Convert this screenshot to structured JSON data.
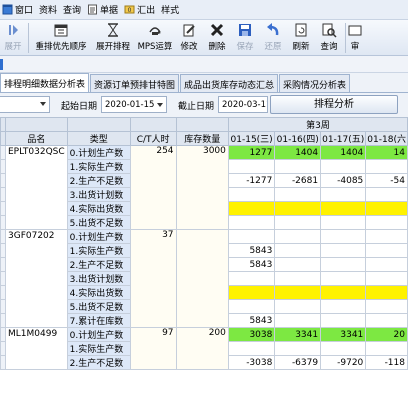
{
  "menubar": {
    "items": [
      {
        "label": "窗口",
        "icon": "window-icon"
      },
      {
        "label": "资料",
        "icon": ""
      },
      {
        "label": "查询",
        "icon": ""
      },
      {
        "label": "单据",
        "icon": "document-icon"
      },
      {
        "label": "汇出",
        "icon": "export-icon"
      },
      {
        "label": "样式",
        "icon": ""
      }
    ]
  },
  "toolbar": {
    "buttons": [
      {
        "label": "展开",
        "disabled": true
      },
      {
        "label": "重排优先顺序",
        "disabled": false
      },
      {
        "label": "展开排程",
        "disabled": false
      },
      {
        "label": "MPS运算",
        "disabled": false
      },
      {
        "label": "修改",
        "disabled": false
      },
      {
        "label": "删除",
        "disabled": false
      },
      {
        "label": "保存",
        "disabled": true
      },
      {
        "label": "还原",
        "disabled": true
      },
      {
        "label": "刷新",
        "disabled": false
      },
      {
        "label": "查询",
        "disabled": false
      },
      {
        "label": "审",
        "disabled": false
      }
    ]
  },
  "tabs": [
    {
      "label": "排程明细数据分析表",
      "active": true
    },
    {
      "label": "资源订单预排甘特图",
      "active": false
    },
    {
      "label": "成品出货库存动态汇总",
      "active": false
    },
    {
      "label": "采购情况分析表",
      "active": false
    }
  ],
  "filter": {
    "start_label": "起始日期",
    "start_date": "2020-01-15",
    "end_label": "截止日期",
    "end_date": "2020-03-11",
    "analyze_button": "排程分析"
  },
  "grid": {
    "week_label": "第3周",
    "headers": {
      "name": "品名",
      "type": "类型",
      "ct": "C/T人时",
      "stock": "库存数量",
      "days": [
        "01-15(三)",
        "01-16(四)",
        "01-17(五)",
        "01-18(六"
      ]
    },
    "groups": [
      {
        "name": "EPLT032QSC",
        "ct": "254",
        "stock": "3000",
        "rows": [
          {
            "type": "0.计划生产数",
            "d": [
              "1277",
              "1404",
              "1404",
              "14"
            ],
            "style": "green"
          },
          {
            "type": "1.实际生产数",
            "d": [
              "",
              "",
              "",
              ""
            ],
            "style": ""
          },
          {
            "type": "2.生产不足数",
            "d": [
              "-1277",
              "-2681",
              "-4085",
              "-54"
            ],
            "style": ""
          },
          {
            "type": "3.出货计划数",
            "d": [
              "",
              "",
              "",
              ""
            ],
            "style": ""
          },
          {
            "type": "4.实际出货数",
            "d": [
              "",
              "",
              "",
              ""
            ],
            "style": "yellow"
          },
          {
            "type": "5.出货不足数",
            "d": [
              "",
              "",
              "",
              ""
            ],
            "style": ""
          }
        ]
      },
      {
        "name": "3GF07202",
        "ct": "37",
        "stock": "",
        "rows": [
          {
            "type": "0.计划生产数",
            "d": [
              "",
              "",
              "",
              ""
            ],
            "style": ""
          },
          {
            "type": "1.实际生产数",
            "d": [
              "5843",
              "",
              "",
              ""
            ],
            "style": ""
          },
          {
            "type": "2.生产不足数",
            "d": [
              "5843",
              "",
              "",
              ""
            ],
            "style": ""
          },
          {
            "type": "3.出货计划数",
            "d": [
              "",
              "",
              "",
              ""
            ],
            "style": ""
          },
          {
            "type": "4.实际出货数",
            "d": [
              "",
              "",
              "",
              ""
            ],
            "style": "yellow"
          },
          {
            "type": "5.出货不足数",
            "d": [
              "",
              "",
              "",
              ""
            ],
            "style": ""
          },
          {
            "type": "7.累计在库数",
            "d": [
              "5843",
              "",
              "",
              ""
            ],
            "style": ""
          }
        ]
      },
      {
        "name": "ML1M0499",
        "ct": "97",
        "stock": "200",
        "rows": [
          {
            "type": "0.计划生产数",
            "d": [
              "3038",
              "3341",
              "3341",
              "20"
            ],
            "style": "green"
          },
          {
            "type": "1.实际生产数",
            "d": [
              "",
              "",
              "",
              ""
            ],
            "style": ""
          },
          {
            "type": "2.生产不足数",
            "d": [
              "-3038",
              "-6379",
              "-9720",
              "-118"
            ],
            "style": ""
          }
        ]
      }
    ]
  }
}
